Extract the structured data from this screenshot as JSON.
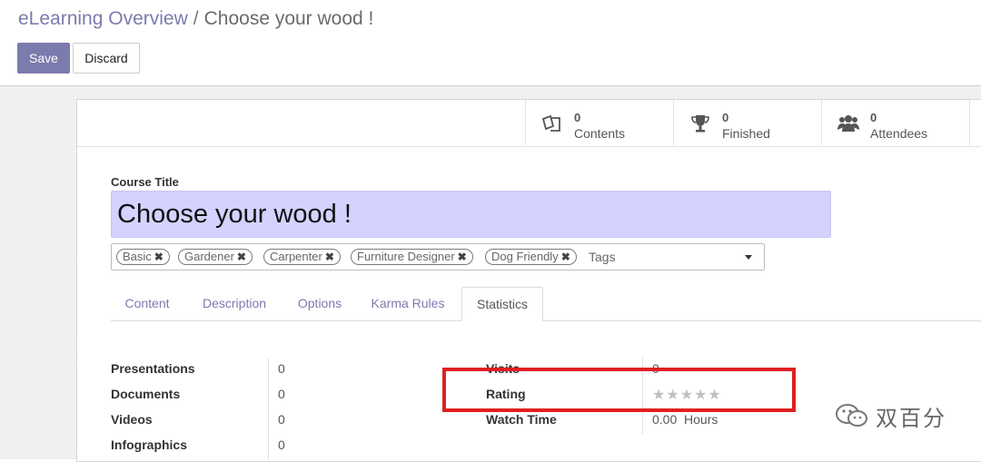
{
  "breadcrumb": {
    "parent": "eLearning Overview",
    "separator": "/",
    "current": "Choose your wood !"
  },
  "toolbar": {
    "save_label": "Save",
    "discard_label": "Discard"
  },
  "stat_buttons": [
    {
      "value": "0",
      "label": "Contents",
      "icon": "documents-icon"
    },
    {
      "value": "0",
      "label": "Finished",
      "icon": "trophy-icon"
    },
    {
      "value": "0",
      "label": "Attendees",
      "icon": "users-icon"
    }
  ],
  "form": {
    "course_title_label": "Course Title",
    "course_title_value": "Choose your wood !",
    "tags": [
      "Basic",
      "Gardener",
      "Carpenter",
      "Furniture Designer",
      "Dog Friendly"
    ],
    "tag_remove_glyph": "✖",
    "tags_placeholder": "Tags"
  },
  "tabs": [
    "Content",
    "Description",
    "Options",
    "Karma Rules",
    "Statistics"
  ],
  "active_tab": "Statistics",
  "statistics": {
    "left": [
      {
        "label": "Presentations",
        "value": "0"
      },
      {
        "label": "Documents",
        "value": "0"
      },
      {
        "label": "Videos",
        "value": "0"
      },
      {
        "label": "Infographics",
        "value": "0"
      }
    ],
    "right": [
      {
        "label": "Visits",
        "value": "0"
      },
      {
        "label": "Rating",
        "stars": 0,
        "max_stars": 5,
        "star_glyphs": "★★★★★"
      },
      {
        "label": "Watch Time",
        "value": "0.00",
        "unit": "Hours"
      }
    ]
  },
  "watermark": {
    "text": "双百分"
  },
  "colors": {
    "accent": "#7c7bad",
    "title_bg": "#d4d2ff",
    "highlight_box": "#e02020"
  }
}
